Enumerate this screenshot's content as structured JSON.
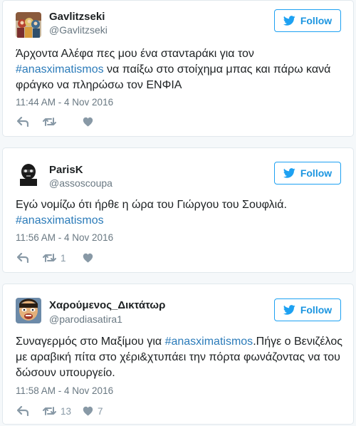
{
  "follow_label": "Follow",
  "colors": {
    "accent": "#1da1f2",
    "link": "#2b7bb9",
    "meta": "#697882",
    "action": "#8899a6"
  },
  "tweets": [
    {
      "name": "Gavlitzseki",
      "handle": "@Gavlitzseki",
      "text_before": "Άρχοντα Αλέφα πες μου ένα σταντaράκι για τον ",
      "hashtag": "#anasximatismos",
      "text_after": " να παίξω στο στοίχημα μπας και πάρω κανά φράγκο να πληρώσω τον ΕΝΦΙΑ",
      "time": "11:44 AM - 4 Nov 2016",
      "retweet_count": "",
      "like_count": ""
    },
    {
      "name": "ParisK",
      "handle": "@assoscoupa",
      "text_before": "Εγώ νομίζω ότι ήρθε η ώρα του Γιώργου του Σουφλιά.",
      "hashtag": "#anasximatismos",
      "text_after": "",
      "time": "11:56 AM - 4 Nov 2016",
      "retweet_count": "1",
      "like_count": ""
    },
    {
      "name": "Χαρούμενος_Δικτάτωρ",
      "handle": "@parodiasatira1",
      "text_before": "Συναγερμός στο Μαξίμου για ",
      "hashtag": "#anasximatismos",
      "text_after": ".Πήγε ο Βενιζέλος με αραβική πίτα στο χέρι&χτυπάει την πόρτα φωνάζοντας να του δώσουν υπουργείο.",
      "time": "11:58 AM - 4 Nov 2016",
      "retweet_count": "13",
      "like_count": "7"
    }
  ],
  "icons": {
    "follow": "twitter-bird-icon",
    "reply": "reply-icon",
    "retweet": "retweet-icon",
    "like": "heart-icon"
  }
}
